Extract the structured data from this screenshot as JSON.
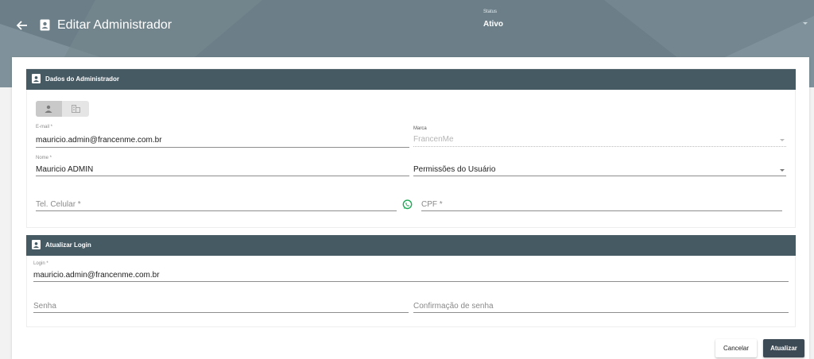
{
  "header": {
    "title": "Editar Administrador",
    "status": {
      "label": "Status",
      "value": "Ativo"
    }
  },
  "admin_section": {
    "title": "Dados do Administrador",
    "toggle": {
      "selected": "person-icon",
      "options": [
        "person-icon",
        "building-icon"
      ]
    },
    "email": {
      "label": "E-mail *",
      "value": "mauricio.admin@francenme.com.br"
    },
    "marca": {
      "label": "Marca",
      "value": "FrancenMe"
    },
    "nome": {
      "label": "Nome *",
      "value": "Mauricio ADMIN"
    },
    "permissoes": {
      "placeholder": "Permissões do Usuário"
    },
    "celular": {
      "placeholder": "Tel. Celular *"
    },
    "cpf": {
      "placeholder": "CPF *"
    }
  },
  "login_section": {
    "title": "Atualizar Login",
    "login": {
      "label": "Login *",
      "value": "mauricio.admin@francenme.com.br"
    },
    "senha": {
      "placeholder": "Senha"
    },
    "confirmacao": {
      "placeholder": "Confirmação de senha"
    }
  },
  "actions": {
    "cancel_label": "Cancelar",
    "update_label": "Atualizar"
  },
  "colors": {
    "header_bg": "#6c7f89",
    "section_bar": "#465a64",
    "primary_button": "#3c4a55",
    "whatsapp_green": "#1fa855"
  }
}
